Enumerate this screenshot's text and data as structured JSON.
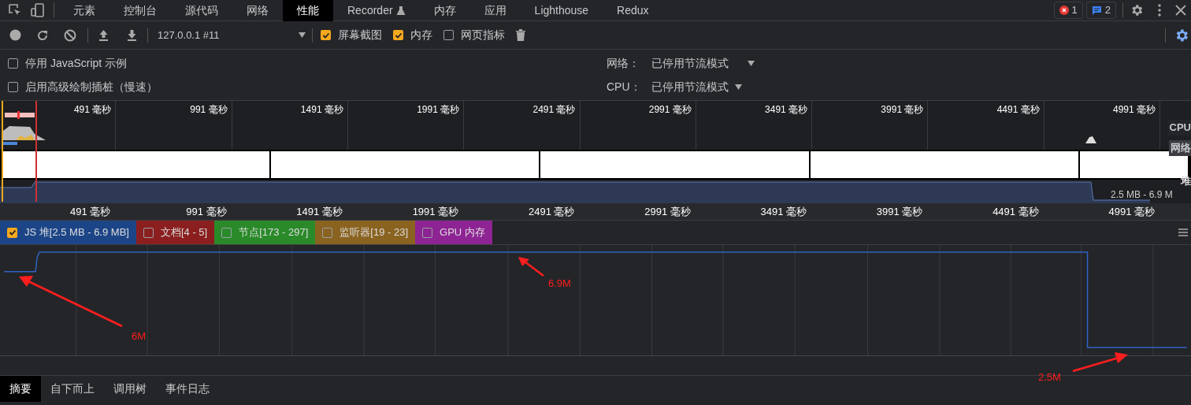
{
  "main_tabs": [
    {
      "label": "元素",
      "selected": false,
      "experimental": false
    },
    {
      "label": "控制台",
      "selected": false,
      "experimental": false
    },
    {
      "label": "源代码",
      "selected": false,
      "experimental": false
    },
    {
      "label": "网络",
      "selected": false,
      "experimental": false
    },
    {
      "label": "性能",
      "selected": true,
      "experimental": false
    },
    {
      "label": "Recorder",
      "selected": false,
      "experimental": true
    },
    {
      "label": "内存",
      "selected": false,
      "experimental": false
    },
    {
      "label": "应用",
      "selected": false,
      "experimental": false
    },
    {
      "label": "Lighthouse",
      "selected": false,
      "experimental": false
    },
    {
      "label": "Redux",
      "selected": false,
      "experimental": false
    }
  ],
  "badges": {
    "errors": "1",
    "messages": "2"
  },
  "toolbar": {
    "recording": "127.0.0.1 #11",
    "checkboxes": [
      {
        "label": "屏幕截图",
        "checked": true
      },
      {
        "label": "内存",
        "checked": true
      },
      {
        "label": "网页指标",
        "checked": false
      }
    ]
  },
  "settings": {
    "checkboxes": [
      {
        "label": "停用 JavaScript 示例",
        "checked": false
      },
      {
        "label": "启用高级绘制插桩（慢速）",
        "checked": false
      }
    ],
    "selects": [
      {
        "label": "网络：",
        "value": "已停用节流模式"
      },
      {
        "label": "CPU：",
        "value": "已停用节流模式"
      }
    ]
  },
  "overview": {
    "time_labels": [
      "491 毫秒",
      "991 毫秒",
      "1491 毫秒",
      "1991 毫秒",
      "2491 毫秒",
      "2991 毫秒",
      "3491 毫秒",
      "3991 毫秒",
      "4491 毫秒",
      "4991 毫秒"
    ],
    "side_labels": [
      "CPU",
      "网络",
      "堆"
    ],
    "heap_range": "2.5 MB - 6.9 M"
  },
  "ruler": [
    "491 毫秒",
    "991 毫秒",
    "1491 毫秒",
    "1991 毫秒",
    "2491 毫秒",
    "2991 毫秒",
    "3491 毫秒",
    "3991 毫秒",
    "4491 毫秒",
    "4991 毫秒"
  ],
  "counters": [
    {
      "label": "JS 堆[2.5 MB - 6.9 MB]",
      "checked": true,
      "color": "#1c4587"
    },
    {
      "label": "文档[4 - 5]",
      "checked": false,
      "color": "#8b1f1f"
    },
    {
      "label": "节点[173 - 297]",
      "checked": false,
      "color": "#2a8a2a"
    },
    {
      "label": "监听器[19 - 23]",
      "checked": false,
      "color": "#8a6320"
    },
    {
      "label": "GPU 内存",
      "checked": false,
      "color": "#8e2494"
    }
  ],
  "annotations": [
    "6M",
    "6.9M",
    "2.5M"
  ],
  "bottom_tabs": [
    {
      "label": "摘要",
      "selected": true
    },
    {
      "label": "自下而上",
      "selected": false
    },
    {
      "label": "调用树",
      "selected": false
    },
    {
      "label": "事件日志",
      "selected": false
    }
  ]
}
